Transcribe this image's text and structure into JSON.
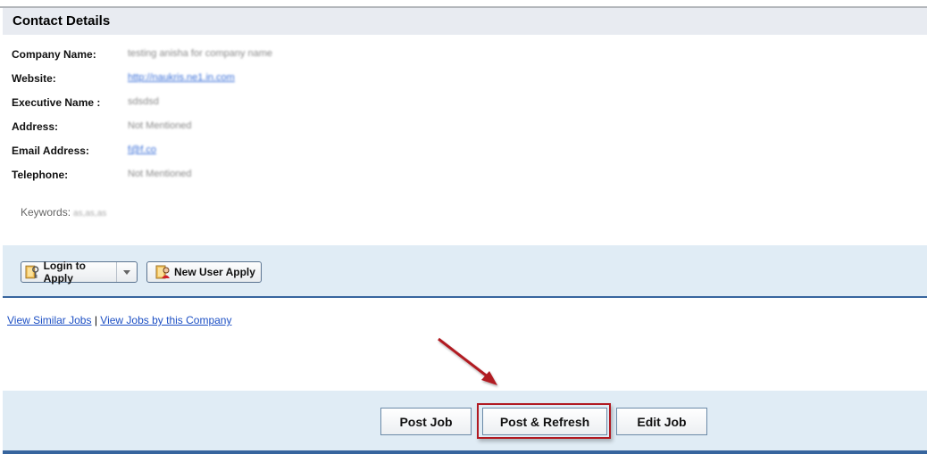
{
  "contact": {
    "title": "Contact Details",
    "fields": [
      {
        "label": "Company Name:",
        "value": "testing anisha for company name",
        "link": false
      },
      {
        "label": "Website:",
        "value": "http://naukris.ne1.in.com",
        "link": true
      },
      {
        "label": "Executive Name :",
        "value": "sdsdsd",
        "link": false
      },
      {
        "label": "Address:",
        "value": "Not Mentioned",
        "link": false
      },
      {
        "label": "Email Address:",
        "value": "f@f.co",
        "link": true
      },
      {
        "label": "Telephone:",
        "value": "Not Mentioned",
        "link": false
      }
    ],
    "keywords_label": "Keywords:",
    "keywords_value": "as,as,as"
  },
  "apply": {
    "login_label": "Login to Apply",
    "login_icon": "key-door-icon",
    "new_user_label": "New User Apply",
    "new_user_icon": "new-user-icon"
  },
  "links": {
    "similar_jobs": "View Similar Jobs",
    "separator": "|",
    "company_jobs": "View Jobs by this Company"
  },
  "actions": {
    "post_job": "Post Job",
    "post_refresh": "Post & Refresh",
    "edit_job": "Edit Job"
  },
  "colors": {
    "header_bg": "#e8ebf1",
    "bar_bg": "#e0ecf5",
    "bar_line": "#37659e",
    "highlight": "#b11a22",
    "link": "#1c4fc4"
  }
}
